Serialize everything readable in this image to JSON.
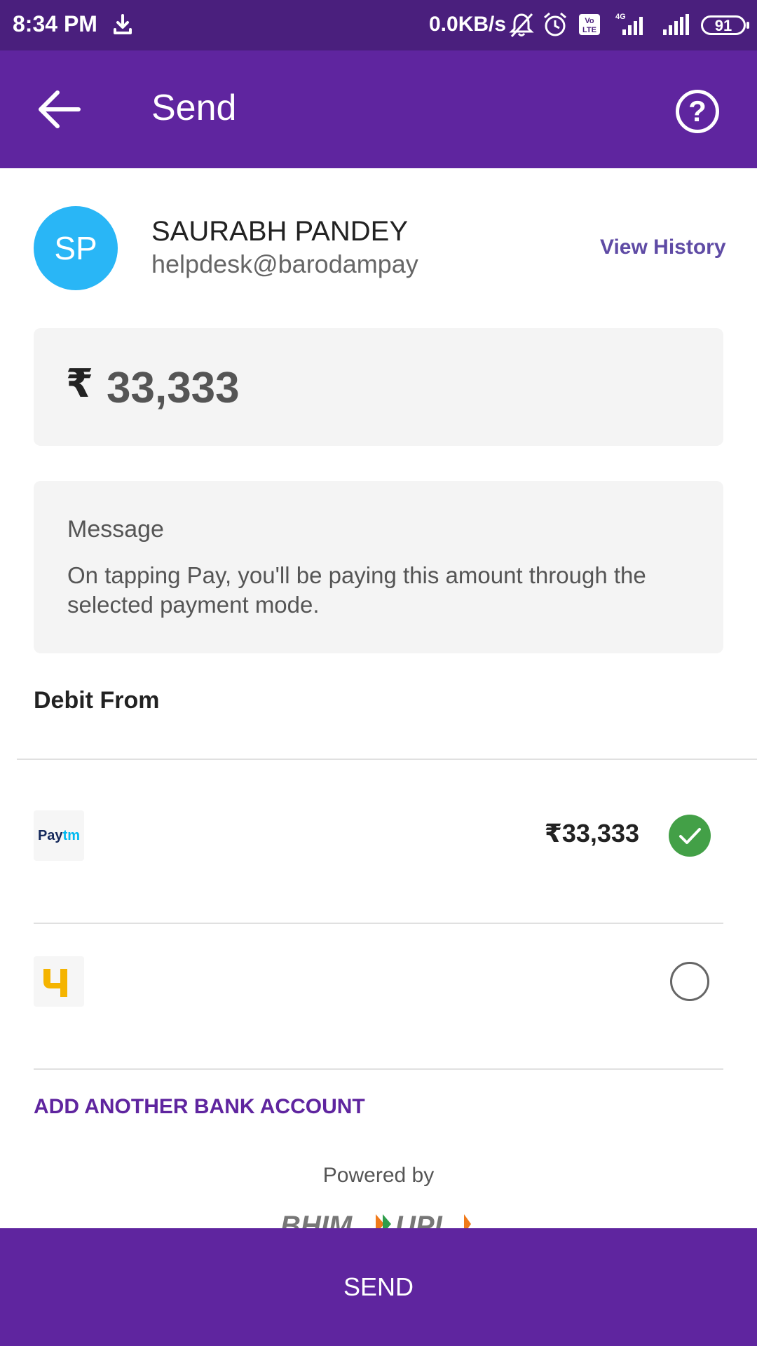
{
  "status_bar": {
    "time": "8:34 PM",
    "network_speed": "0.0KB/s",
    "network_type": "4G",
    "volte": "Vo LTE",
    "battery": "91"
  },
  "app_bar": {
    "title": "Send"
  },
  "payee": {
    "initials": "SP",
    "name": "SAURABH PANDEY",
    "vpa": "helpdesk@barodampay",
    "view_history_label": "View History",
    "avatar_color": "#29b6f6"
  },
  "amount": {
    "currency_symbol": "₹",
    "value": "33,333"
  },
  "message": {
    "label": "Message",
    "text": "On tapping Pay, you'll be paying this amount through the selected payment mode."
  },
  "debit": {
    "label": "Debit From",
    "accounts": [
      {
        "logo_text_a": "Pay",
        "logo_text_b": "tm",
        "balance": "₹33,333",
        "selected": true
      },
      {
        "logo_text": "",
        "balance": "",
        "selected": false
      }
    ]
  },
  "add_bank_label": "ADD ANOTHER BANK ACCOUNT",
  "powered_by": "Powered by",
  "send_label": "SEND",
  "colors": {
    "primary": "#5f259f",
    "status_bar": "#4a1f7d",
    "selected": "#43a047",
    "link": "#5f4ba5"
  }
}
